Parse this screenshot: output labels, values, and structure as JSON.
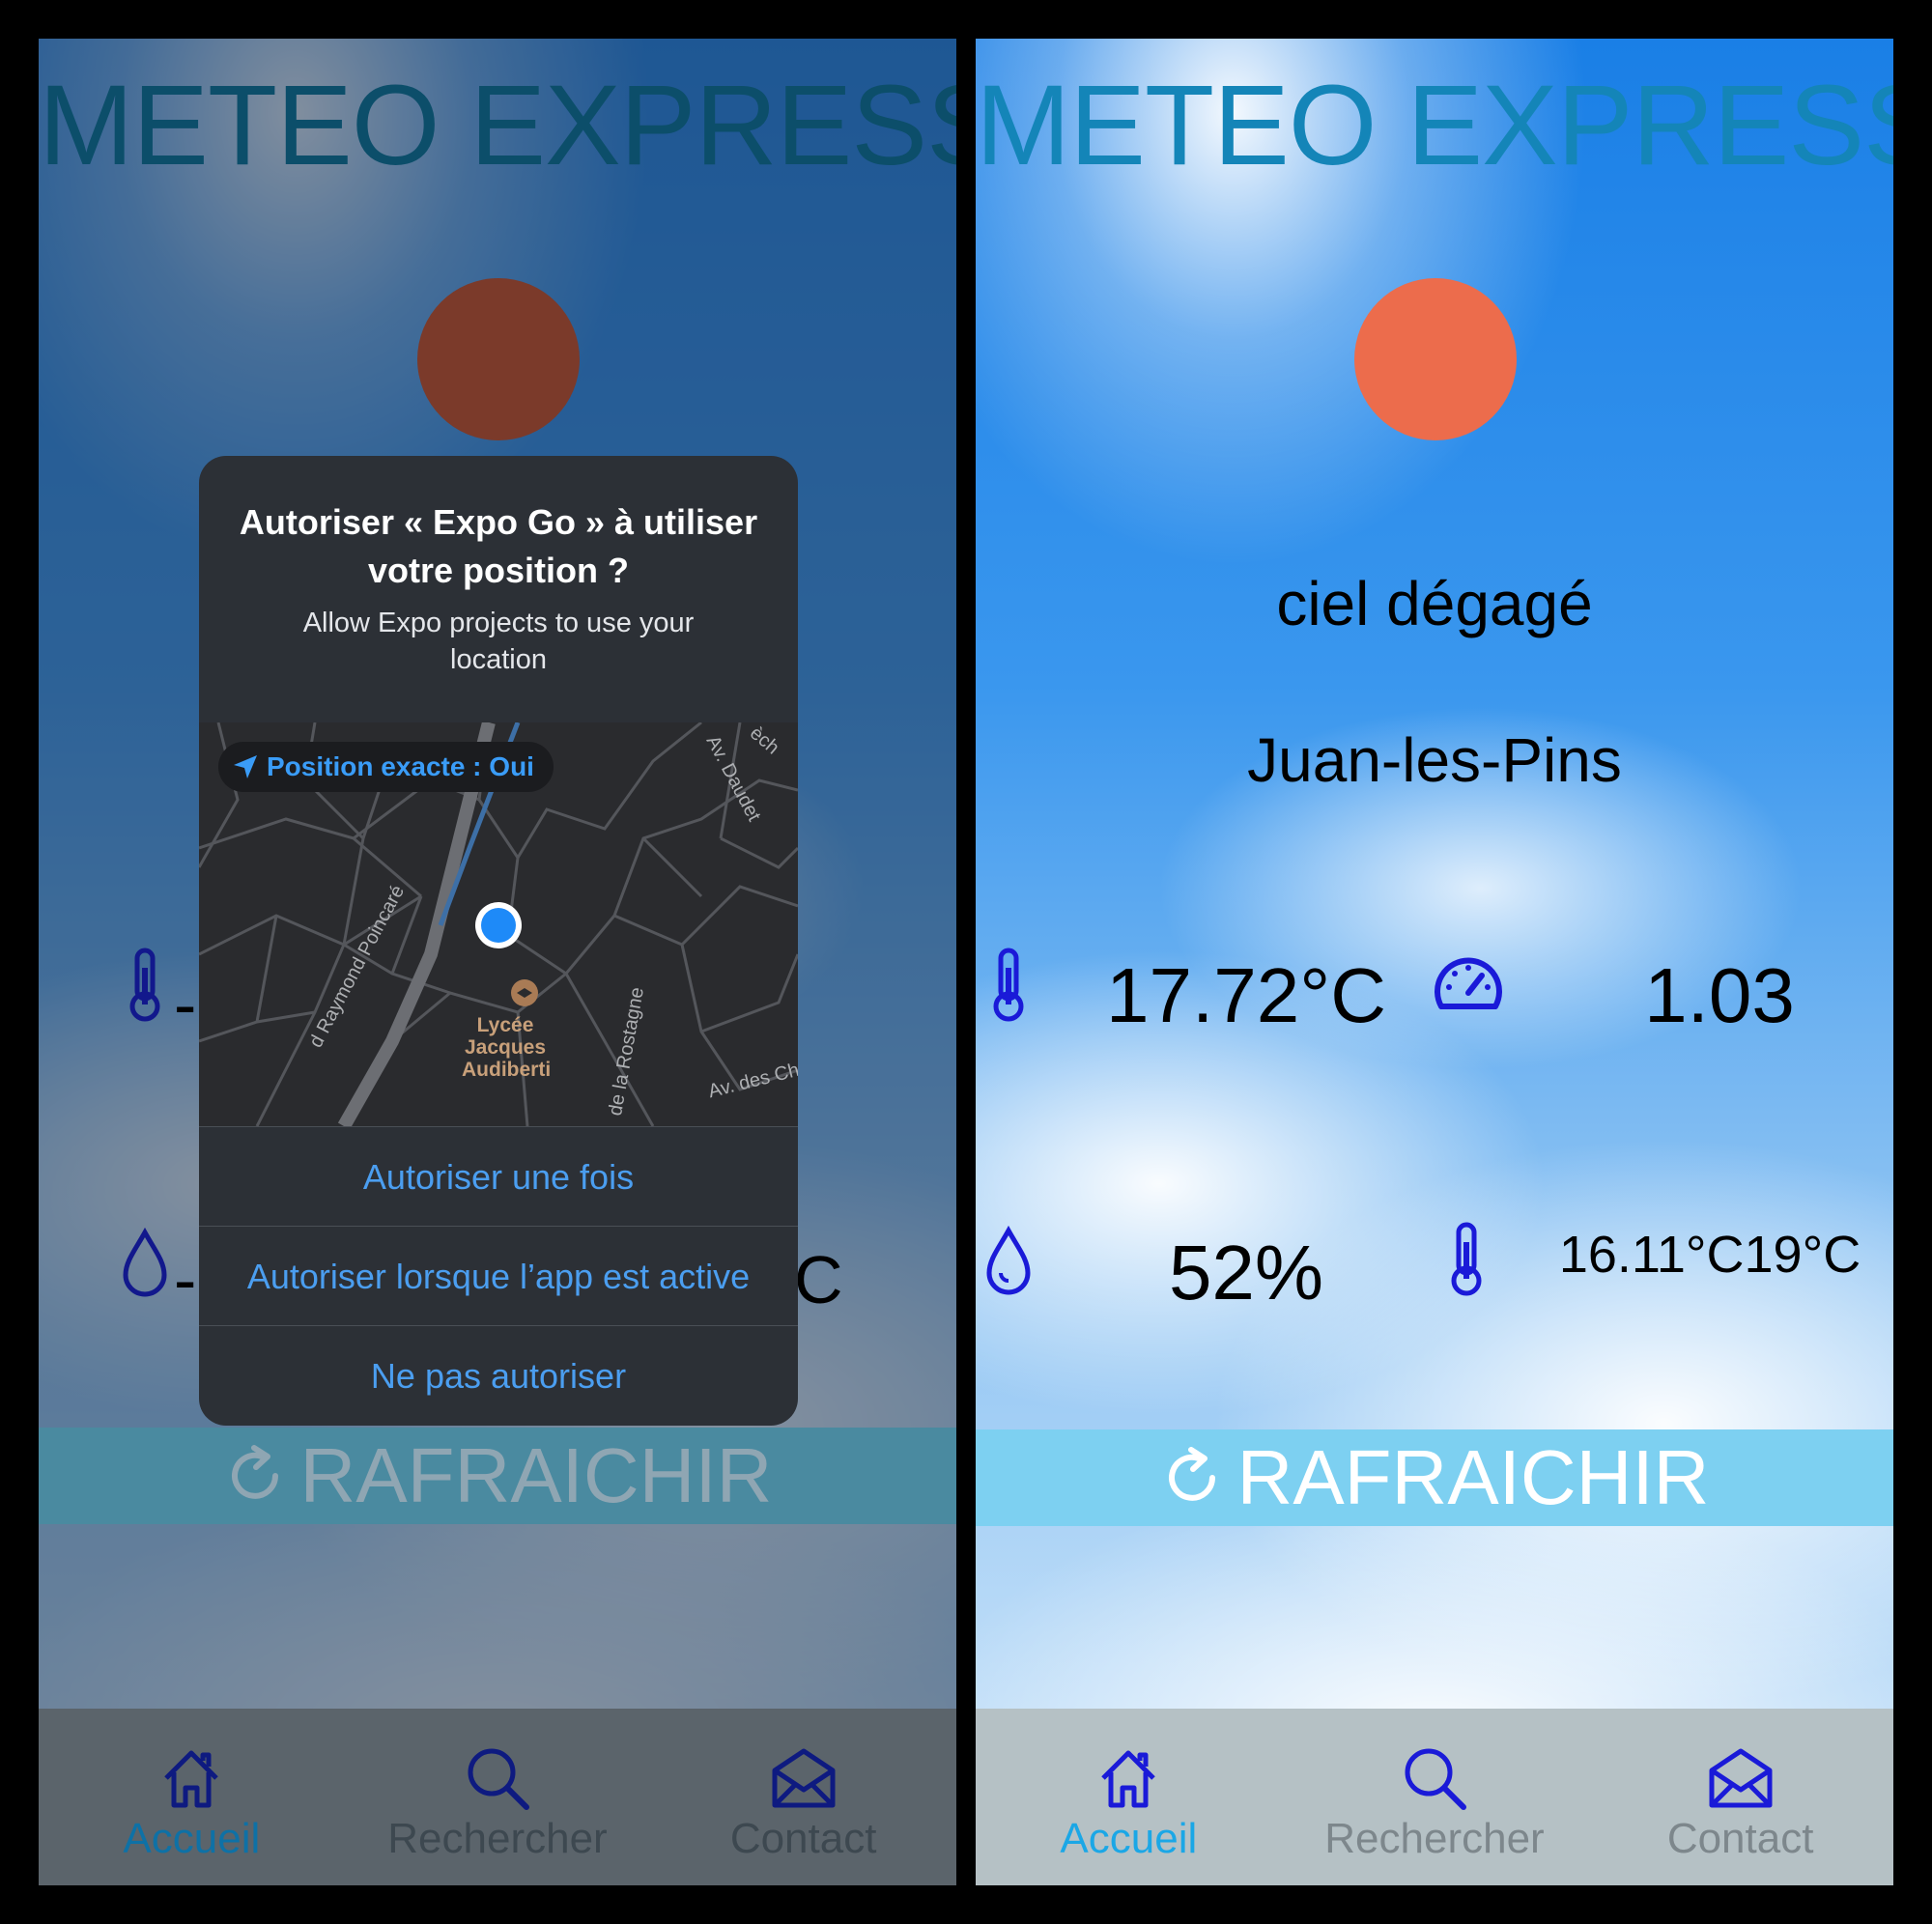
{
  "app": {
    "title": "METEO EXPRESS"
  },
  "colors": {
    "accent": "#1ba7e6",
    "sun": "#ec6c4c",
    "refresh_bar": "#7dd0f1",
    "icon_blue": "#1a1ad8",
    "tabbar": "#b5c1c5"
  },
  "left": {
    "dialog": {
      "title": "Autoriser « Expo Go » à utiliser votre position ?",
      "message": "Allow Expo projects to use your location",
      "precise_pill": "Position exacte : Oui",
      "map_labels": {
        "poi": "Lycée Jacques Audiberti",
        "street1": "d Raymond Poincaré",
        "street2": "de la Rostagne",
        "street3": "Av. des Ch",
        "street4": "Av. Daudet",
        "street5": "èch"
      },
      "buttons": [
        "Autoriser une fois",
        "Autoriser lorsque l’app est active",
        "Ne pas autoriser"
      ]
    },
    "partial_values": {
      "temp": "-",
      "humidity": "-",
      "minmax_tail": "C"
    }
  },
  "right": {
    "description": "ciel dégagé",
    "city": "Juan-les-Pins",
    "temperature": "17.72°C",
    "wind": "1.03",
    "humidity": "52%",
    "minmax": "16.11°C19°C"
  },
  "refresh": {
    "label": "RAFRAICHIR"
  },
  "tabs": [
    {
      "label": "Accueil",
      "icon": "home-icon",
      "active": true
    },
    {
      "label": "Rechercher",
      "icon": "search-icon",
      "active": false
    },
    {
      "label": "Contact",
      "icon": "mail-icon",
      "active": false
    }
  ]
}
